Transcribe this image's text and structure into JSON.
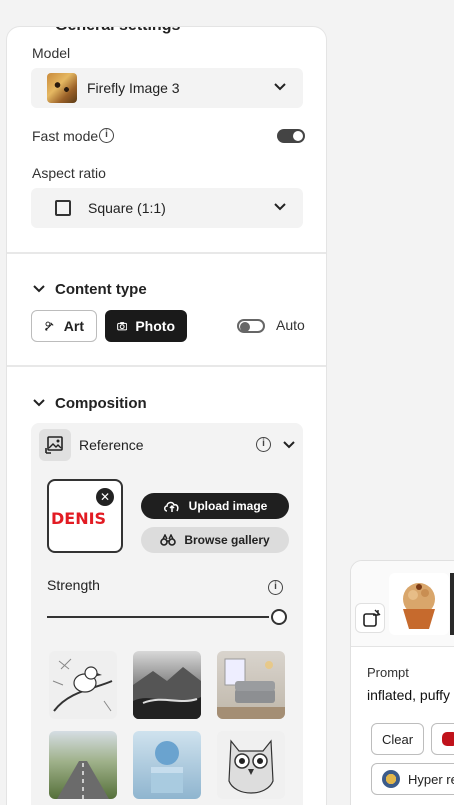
{
  "general": {
    "title": "General settings",
    "model_label": "Model",
    "model_value": "Firefly Image 3",
    "fast_mode_label": "Fast mode",
    "fast_mode_on": true,
    "aspect_label": "Aspect ratio",
    "aspect_value": "Square (1:1)"
  },
  "content_type": {
    "title": "Content type",
    "art_label": "Art",
    "photo_label": "Photo",
    "auto_label": "Auto",
    "auto_on": false,
    "selected": "Photo"
  },
  "composition": {
    "title": "Composition",
    "reference_label": "Reference",
    "reference_image_text": "DENIS",
    "upload_label": "Upload image",
    "browse_label": "Browse gallery",
    "strength_label": "Strength",
    "strength_value": 1.0
  },
  "prompt_card": {
    "prompt_label": "Prompt",
    "prompt_value": "inflated, puffy",
    "clear_label": "Clear",
    "style_chip_label": "Hyper re"
  },
  "colors": {
    "accent_dark": "#1a1a1a",
    "brand_red": "#e21b23"
  }
}
